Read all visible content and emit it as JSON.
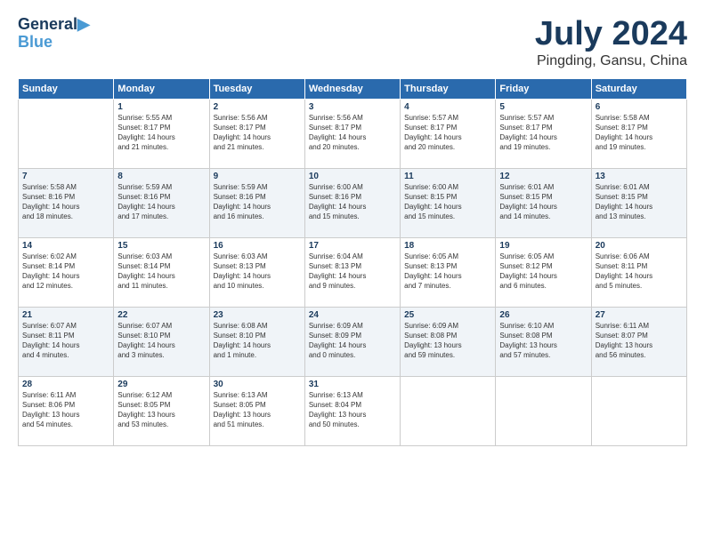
{
  "header": {
    "logo_line1": "General",
    "logo_line2": "Blue",
    "month_title": "July 2024",
    "location": "Pingding, Gansu, China"
  },
  "weekdays": [
    "Sunday",
    "Monday",
    "Tuesday",
    "Wednesday",
    "Thursday",
    "Friday",
    "Saturday"
  ],
  "weeks": [
    [
      {
        "day": "",
        "info": ""
      },
      {
        "day": "1",
        "info": "Sunrise: 5:55 AM\nSunset: 8:17 PM\nDaylight: 14 hours\nand 21 minutes."
      },
      {
        "day": "2",
        "info": "Sunrise: 5:56 AM\nSunset: 8:17 PM\nDaylight: 14 hours\nand 21 minutes."
      },
      {
        "day": "3",
        "info": "Sunrise: 5:56 AM\nSunset: 8:17 PM\nDaylight: 14 hours\nand 20 minutes."
      },
      {
        "day": "4",
        "info": "Sunrise: 5:57 AM\nSunset: 8:17 PM\nDaylight: 14 hours\nand 20 minutes."
      },
      {
        "day": "5",
        "info": "Sunrise: 5:57 AM\nSunset: 8:17 PM\nDaylight: 14 hours\nand 19 minutes."
      },
      {
        "day": "6",
        "info": "Sunrise: 5:58 AM\nSunset: 8:17 PM\nDaylight: 14 hours\nand 19 minutes."
      }
    ],
    [
      {
        "day": "7",
        "info": "Sunrise: 5:58 AM\nSunset: 8:16 PM\nDaylight: 14 hours\nand 18 minutes."
      },
      {
        "day": "8",
        "info": "Sunrise: 5:59 AM\nSunset: 8:16 PM\nDaylight: 14 hours\nand 17 minutes."
      },
      {
        "day": "9",
        "info": "Sunrise: 5:59 AM\nSunset: 8:16 PM\nDaylight: 14 hours\nand 16 minutes."
      },
      {
        "day": "10",
        "info": "Sunrise: 6:00 AM\nSunset: 8:16 PM\nDaylight: 14 hours\nand 15 minutes."
      },
      {
        "day": "11",
        "info": "Sunrise: 6:00 AM\nSunset: 8:15 PM\nDaylight: 14 hours\nand 15 minutes."
      },
      {
        "day": "12",
        "info": "Sunrise: 6:01 AM\nSunset: 8:15 PM\nDaylight: 14 hours\nand 14 minutes."
      },
      {
        "day": "13",
        "info": "Sunrise: 6:01 AM\nSunset: 8:15 PM\nDaylight: 14 hours\nand 13 minutes."
      }
    ],
    [
      {
        "day": "14",
        "info": "Sunrise: 6:02 AM\nSunset: 8:14 PM\nDaylight: 14 hours\nand 12 minutes."
      },
      {
        "day": "15",
        "info": "Sunrise: 6:03 AM\nSunset: 8:14 PM\nDaylight: 14 hours\nand 11 minutes."
      },
      {
        "day": "16",
        "info": "Sunrise: 6:03 AM\nSunset: 8:13 PM\nDaylight: 14 hours\nand 10 minutes."
      },
      {
        "day": "17",
        "info": "Sunrise: 6:04 AM\nSunset: 8:13 PM\nDaylight: 14 hours\nand 9 minutes."
      },
      {
        "day": "18",
        "info": "Sunrise: 6:05 AM\nSunset: 8:13 PM\nDaylight: 14 hours\nand 7 minutes."
      },
      {
        "day": "19",
        "info": "Sunrise: 6:05 AM\nSunset: 8:12 PM\nDaylight: 14 hours\nand 6 minutes."
      },
      {
        "day": "20",
        "info": "Sunrise: 6:06 AM\nSunset: 8:11 PM\nDaylight: 14 hours\nand 5 minutes."
      }
    ],
    [
      {
        "day": "21",
        "info": "Sunrise: 6:07 AM\nSunset: 8:11 PM\nDaylight: 14 hours\nand 4 minutes."
      },
      {
        "day": "22",
        "info": "Sunrise: 6:07 AM\nSunset: 8:10 PM\nDaylight: 14 hours\nand 3 minutes."
      },
      {
        "day": "23",
        "info": "Sunrise: 6:08 AM\nSunset: 8:10 PM\nDaylight: 14 hours\nand 1 minute."
      },
      {
        "day": "24",
        "info": "Sunrise: 6:09 AM\nSunset: 8:09 PM\nDaylight: 14 hours\nand 0 minutes."
      },
      {
        "day": "25",
        "info": "Sunrise: 6:09 AM\nSunset: 8:08 PM\nDaylight: 13 hours\nand 59 minutes."
      },
      {
        "day": "26",
        "info": "Sunrise: 6:10 AM\nSunset: 8:08 PM\nDaylight: 13 hours\nand 57 minutes."
      },
      {
        "day": "27",
        "info": "Sunrise: 6:11 AM\nSunset: 8:07 PM\nDaylight: 13 hours\nand 56 minutes."
      }
    ],
    [
      {
        "day": "28",
        "info": "Sunrise: 6:11 AM\nSunset: 8:06 PM\nDaylight: 13 hours\nand 54 minutes."
      },
      {
        "day": "29",
        "info": "Sunrise: 6:12 AM\nSunset: 8:05 PM\nDaylight: 13 hours\nand 53 minutes."
      },
      {
        "day": "30",
        "info": "Sunrise: 6:13 AM\nSunset: 8:05 PM\nDaylight: 13 hours\nand 51 minutes."
      },
      {
        "day": "31",
        "info": "Sunrise: 6:13 AM\nSunset: 8:04 PM\nDaylight: 13 hours\nand 50 minutes."
      },
      {
        "day": "",
        "info": ""
      },
      {
        "day": "",
        "info": ""
      },
      {
        "day": "",
        "info": ""
      }
    ]
  ]
}
